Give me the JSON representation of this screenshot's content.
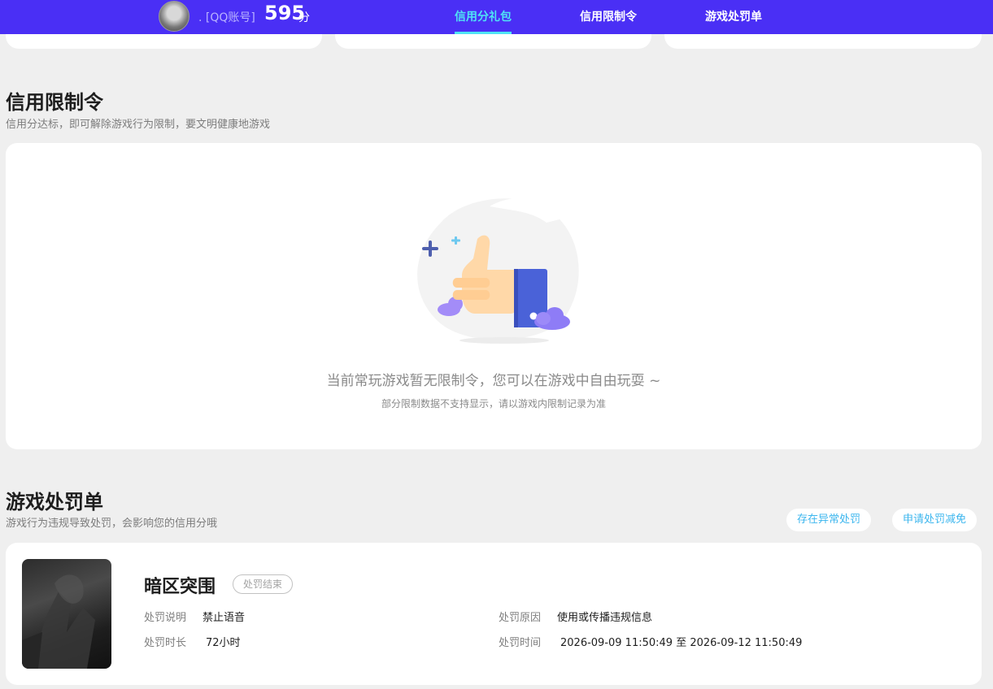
{
  "header": {
    "account_prefix": ".",
    "account_label": "[QQ账号]",
    "score": "595",
    "score_unit": "分",
    "tabs": [
      {
        "label": "信用分礼包",
        "active": true
      },
      {
        "label": "信用限制令",
        "active": false
      },
      {
        "label": "游戏处罚单",
        "active": false
      }
    ],
    "accent_color": "#4a2ff5",
    "active_tab_color": "#4fe3f5"
  },
  "restrictions": {
    "title": "信用限制令",
    "subtitle": "信用分达标，即可解除游戏行为限制，要文明健康地游戏",
    "empty_icon": "thumbs-up-illustration",
    "empty_message": "当前常玩游戏暂无限制令，您可以在游戏中自由玩耍 ~",
    "empty_note": "部分限制数据不支持显示，请以游戏内限制记录为准"
  },
  "penalties": {
    "title": "游戏处罚单",
    "subtitle": "游戏行为违规导致处罚，会影响您的信用分哦",
    "actions": {
      "report_abnormal": "存在异常处罚",
      "apply_reduction": "申请处罚减免"
    },
    "items": [
      {
        "game": "暗区突围",
        "status": "处罚结束",
        "desc_label": "处罚说明",
        "desc_value": "禁止语音",
        "reason_label": "处罚原因",
        "reason_value": "使用或传播违规信息",
        "duration_label": "处罚时长",
        "duration_value": "72小时",
        "time_label": "处罚时间",
        "time_value": "2026-09-09 11:50:49 至 2026-09-12 11:50:49"
      }
    ]
  }
}
